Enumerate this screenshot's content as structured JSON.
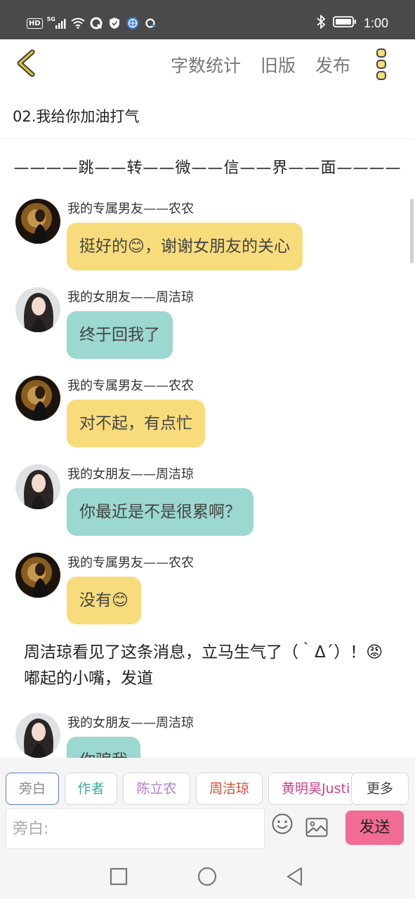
{
  "status_bar": {
    "network_badge": "HD",
    "signal_label": "5G",
    "time": "1:00",
    "icons": [
      "signal-icon",
      "wifi-icon",
      "app-notification-icon",
      "shield-icon",
      "browser-icon",
      "app-icon",
      "bluetooth-icon",
      "battery-icon"
    ]
  },
  "header": {
    "back_icon": "chevron-left-icon",
    "actions": [
      "字数统计",
      "旧版",
      "发布"
    ],
    "more_icon": "three-dots-vertical-icon",
    "accent_color": "#d9c43a"
  },
  "chapter_title": "02.我给你加油打气",
  "content": {
    "divider": "————跳——转——微——信——界——面————",
    "messages": [
      {
        "sender": "我的专属男友——农农",
        "text": "挺好的😊，谢谢女朋友的关心",
        "color": "#f8dc7c",
        "avatar": "male-avatar"
      },
      {
        "sender": "我的女朋友——周洁琼",
        "text": "终于回我了",
        "color": "#9bd8cf",
        "avatar": "female-avatar"
      },
      {
        "sender": "我的专属男友——农农",
        "text": "对不起，有点忙",
        "color": "#f8dc7c",
        "avatar": "male-avatar"
      },
      {
        "sender": "我的女朋友——周洁琼",
        "text": "你最近是不是很累啊？",
        "color": "#9bd8cf",
        "avatar": "female-avatar"
      },
      {
        "sender": "我的专属男友——农农",
        "text": "没有😊",
        "color": "#f8dc7c",
        "avatar": "male-avatar"
      }
    ],
    "narration": "周洁琼看见了这条消息，立马生气了（｀Δ´）！😡嘟起的小嘴，发道",
    "last_message": {
      "sender": "我的女朋友——周洁琼",
      "text": "你骗我",
      "color": "#9bd8cf",
      "avatar": "female-avatar"
    }
  },
  "composer": {
    "roles": [
      {
        "label": "旁白",
        "color": "#888888",
        "active": true
      },
      {
        "label": "作者",
        "color": "#3fa99d",
        "active": false
      },
      {
        "label": "陈立农",
        "color": "#b27cc7",
        "active": false
      },
      {
        "label": "周洁琼",
        "color": "#d0503c",
        "active": false
      },
      {
        "label": "黄明昊Justin",
        "color": "#c8448a",
        "active": false
      }
    ],
    "more_label": "更多",
    "input_placeholder": "旁白:",
    "send_label": "发送",
    "send_color": "#f06c94"
  },
  "nav": [
    "recent-apps-icon",
    "home-icon",
    "back-icon"
  ]
}
